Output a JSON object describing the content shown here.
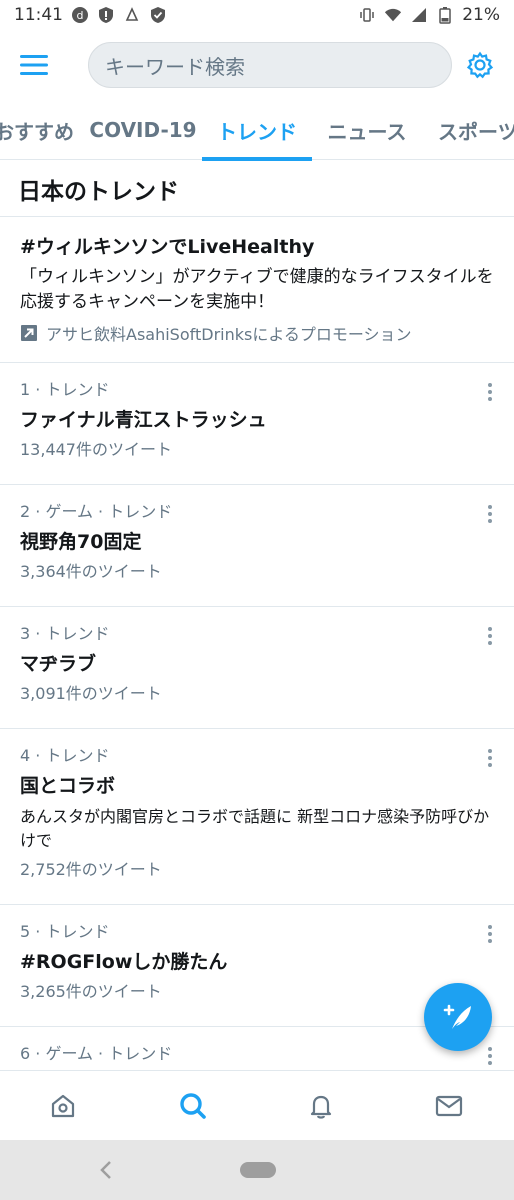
{
  "status_bar": {
    "time": "11:41",
    "battery": "21%"
  },
  "search": {
    "placeholder": "キーワード検索"
  },
  "tabs": [
    {
      "label": "おすすめ"
    },
    {
      "label": "COVID-19"
    },
    {
      "label": "トレンド"
    },
    {
      "label": "ニュース"
    },
    {
      "label": "スポーツ"
    }
  ],
  "section_title": "日本のトレンド",
  "promo": {
    "title": "#ウィルキンソンでLiveHealthy",
    "description": "「ウィルキンソン」がアクティブで健康的なライフスタイルを応援するキャンペーンを実施中！",
    "promoted_by": "アサヒ飲料AsahiSoftDrinksによるプロモーション"
  },
  "trends": [
    {
      "meta": "1 · トレンド",
      "name": "ファイナル青江ストラッシュ",
      "count": "13,447件のツイート"
    },
    {
      "meta": "2 · ゲーム · トレンド",
      "name": "視野角70固定",
      "count": "3,364件のツイート"
    },
    {
      "meta": "3 · トレンド",
      "name": "マヂラブ",
      "count": "3,091件のツイート"
    },
    {
      "meta": "4 · トレンド",
      "name": "国とコラボ",
      "description": "あんスタが内閣官房とコラボで話題に 新型コロナ感染予防呼びかけで",
      "count": "2,752件のツイート"
    },
    {
      "meta": "5 · トレンド",
      "name": "#ROGFlowしか勝たん",
      "count": "3,265件のツイート"
    },
    {
      "meta": "6 · ゲーム · トレンド"
    }
  ],
  "colors": {
    "accent": "#1da1f2",
    "secondary_text": "#657786",
    "divider": "#e1e8ed"
  },
  "icons": {
    "header": [
      "menu-icon",
      "settings-icon"
    ],
    "bottom_nav": [
      "home-icon",
      "search-icon",
      "notifications-icon",
      "messages-icon"
    ],
    "fab": "compose-tweet-icon"
  }
}
